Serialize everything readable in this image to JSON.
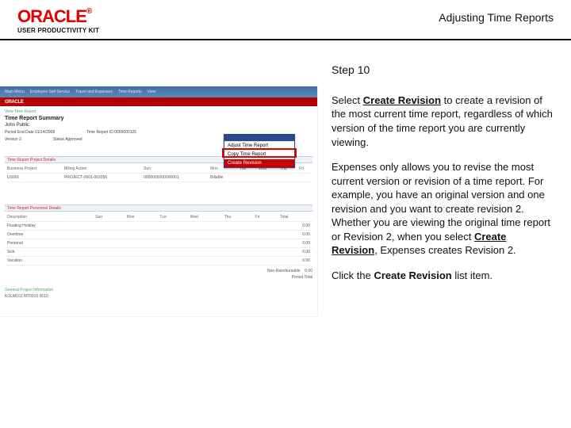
{
  "header": {
    "logo_text": "ORACLE",
    "logo_sub": "USER PRODUCTIVITY KIT",
    "doc_title": "Adjusting Time Reports"
  },
  "guide": {
    "step_label": "Step 10",
    "p1_a": "Select ",
    "p1_bold": "Create Revision",
    "p1_b": " to create a revision of the most current time report, regardless of which version of the time report you are currently viewing.",
    "p2_a": "Expenses only allows you to revise the most current version or revision of a time report. For example, you have an original version and one revision and you want to create revision 2. Whether you are viewing the original time report or Revision 2, when you select ",
    "p2_bold": "Create Revision",
    "p2_b": ", Expenses creates Revision 2.",
    "p3_a": "Click the ",
    "p3_bold": "Create Revision",
    "p3_b": " list item."
  },
  "app": {
    "brand": "ORACLE",
    "tabs": [
      "Main Menu",
      "Employee Self Service",
      "Travel and Expenses",
      "Time Reports",
      "View"
    ],
    "crumb": "View Time Report",
    "title": "Time Report Summary",
    "sub": "John Public",
    "period_end_lbl": "Period End Date",
    "period_end_val": "01/14/2008",
    "report_id_lbl": "Time Report ID",
    "report_id_val": "0000000125",
    "version_lbl": "Version",
    "version_val": "2",
    "status_lbl": "Status",
    "status_val": "Approved",
    "dropdown": [
      "Adjust Time Report",
      "Copy Time Report",
      "Create Revision"
    ],
    "section1": "Time Report Project Details",
    "tbl1_headers": [
      "Business Project",
      "Billing Action",
      "Sun",
      "Mon",
      "Tue",
      "Wed",
      "Thu",
      "Fri"
    ],
    "tbl1_row": [
      "US001",
      "PROJECT-0001-002056",
      "0000000000000001",
      "Billable",
      "",
      "",
      "",
      "",
      "",
      ""
    ],
    "section2": "Time Report Personnel Details",
    "tbl2_headers": [
      "Description",
      "Sun",
      "Mon",
      "Tue",
      "Wed",
      "Thu",
      "Fri",
      "Total"
    ],
    "tbl2_rows": [
      [
        "Floating Holiday",
        "",
        "",
        "",
        "",
        "",
        "",
        "0.00"
      ],
      [
        "Overtime",
        "",
        "",
        "",
        "",
        "",
        "",
        "0.00"
      ],
      [
        "Personal",
        "",
        "",
        "",
        "",
        "",
        "",
        "0.00"
      ],
      [
        "Sick",
        "",
        "",
        "",
        "",
        "",
        "",
        "0.00"
      ],
      [
        "Vacation",
        "",
        "",
        "",
        "",
        "",
        "",
        "0.00"
      ]
    ],
    "non_reimb_lbl": "Non-Reimbursable",
    "non_reimb_val": "0.00",
    "period_total_lbl": "Period Total",
    "footer1": "General Project Information",
    "footer2": "KOLM101 MT0010 0010"
  }
}
